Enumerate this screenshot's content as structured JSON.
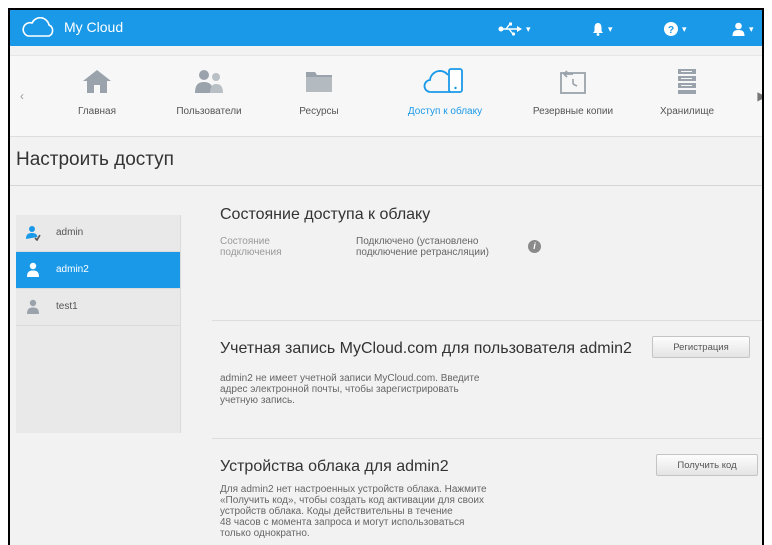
{
  "topbar": {
    "app_title": "My Cloud",
    "icons": [
      "usb-icon",
      "bell-icon",
      "help-icon",
      "user-icon"
    ]
  },
  "nav": {
    "items": [
      {
        "label": "Главная",
        "icon": "home-icon"
      },
      {
        "label": "Пользователи",
        "icon": "users-icon"
      },
      {
        "label": "Ресурсы",
        "icon": "folder-icon"
      },
      {
        "label": "Доступ к облаку",
        "icon": "cloud-device-icon",
        "active": true
      },
      {
        "label": "Резервные копии",
        "icon": "backup-icon"
      },
      {
        "label": "Хранилище",
        "icon": "storage-icon"
      }
    ]
  },
  "page": {
    "title": "Настроить доступ"
  },
  "sidebar": {
    "users": [
      {
        "name": "admin",
        "icon": "admin-user-icon"
      },
      {
        "name": "admin2",
        "icon": "user-icon",
        "selected": true
      },
      {
        "name": "test1",
        "icon": "user-icon"
      }
    ]
  },
  "cloud_status": {
    "title": "Состояние доступа к облаку",
    "label_line1": "Состояние",
    "label_line2": "подключения",
    "value_line1": "Подключено (установлено",
    "value_line2": "подключение ретрансляции)"
  },
  "account": {
    "title": "Учетная запись MyCloud.com для пользователя admin2",
    "register_button": "Регистрация",
    "desc_line1": "admin2 не имеет учетной записи MyCloud.com. Введите",
    "desc_line2": "адрес электронной почты, чтобы зарегистрировать",
    "desc_line3": "учетную запись."
  },
  "devices": {
    "title": "Устройства облака для admin2",
    "get_code_button": "Получить код",
    "desc_line1": "Для admin2 нет настроенных устройств облака. Нажмите",
    "desc_line2": "«Получить код», чтобы создать код активации для своих",
    "desc_line3": "устройств облака. Коды действительны в течение",
    "desc_line4": "48 часов с момента запроса и могут использоваться",
    "desc_line5": "только однократно."
  },
  "colors": {
    "accent": "#1a99e8",
    "background": "#f2f2f2",
    "sidebar": "#e9e9e9"
  }
}
